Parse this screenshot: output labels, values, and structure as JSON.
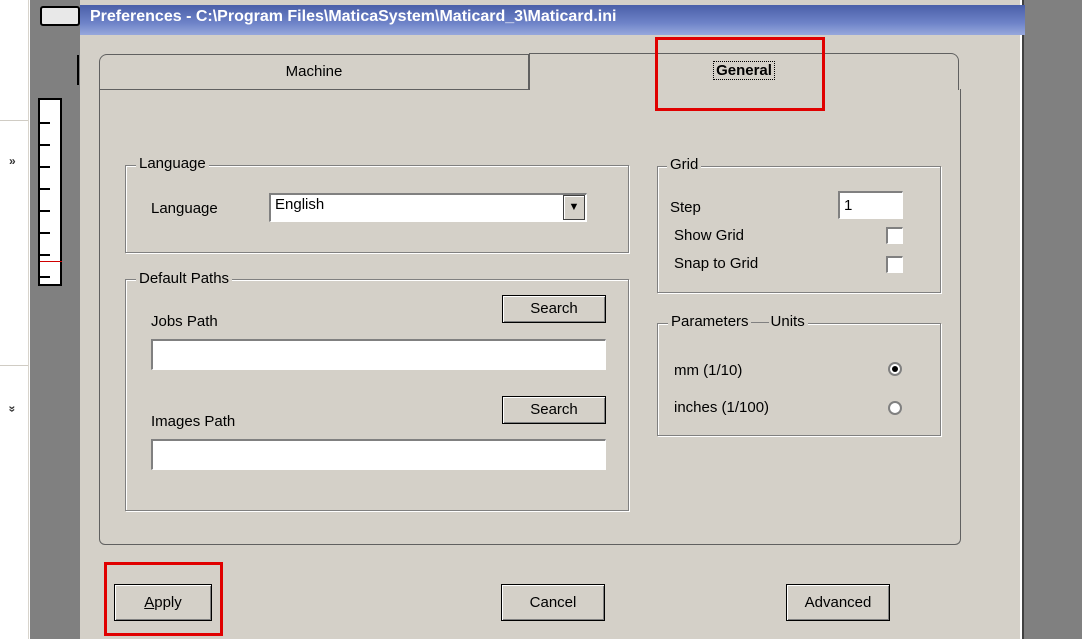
{
  "window": {
    "title": "Preferences - C:\\Program Files\\MaticaSystem\\Maticard_3\\Maticard.ini"
  },
  "outer": {
    "chevron_up": "»",
    "chevron_down": "»"
  },
  "tabs": {
    "machine_label": "Machine",
    "general_label": "General",
    "active": "General"
  },
  "language_group": {
    "legend": "Language",
    "label": "Language",
    "selected": "English",
    "dropdown_glyph": "▼"
  },
  "paths_group": {
    "legend": "Default Paths",
    "jobs_label": "Jobs Path",
    "jobs_value": "",
    "jobs_search_label": "Search",
    "images_label": "Images Path",
    "images_value": "",
    "images_search_label": "Search"
  },
  "grid_group": {
    "legend": "Grid",
    "step_label": "Step",
    "step_value": "1",
    "show_grid_label": "Show Grid",
    "show_grid_checked": false,
    "snap_label": "Snap to Grid",
    "snap_checked": false
  },
  "units_group": {
    "legend": "Parameters",
    "legend_suffix": "Units",
    "mm_label": "mm (1/10)",
    "inches_label": "inches (1/100)",
    "selected": "mm (1/10)"
  },
  "buttons": {
    "apply_label_underlined": "A",
    "apply_label_rest": "pply",
    "cancel_label": "Cancel",
    "advanced_label": "Advanced"
  },
  "highlight_color": "#e00000",
  "titlebar_color": "#4a5fa8"
}
